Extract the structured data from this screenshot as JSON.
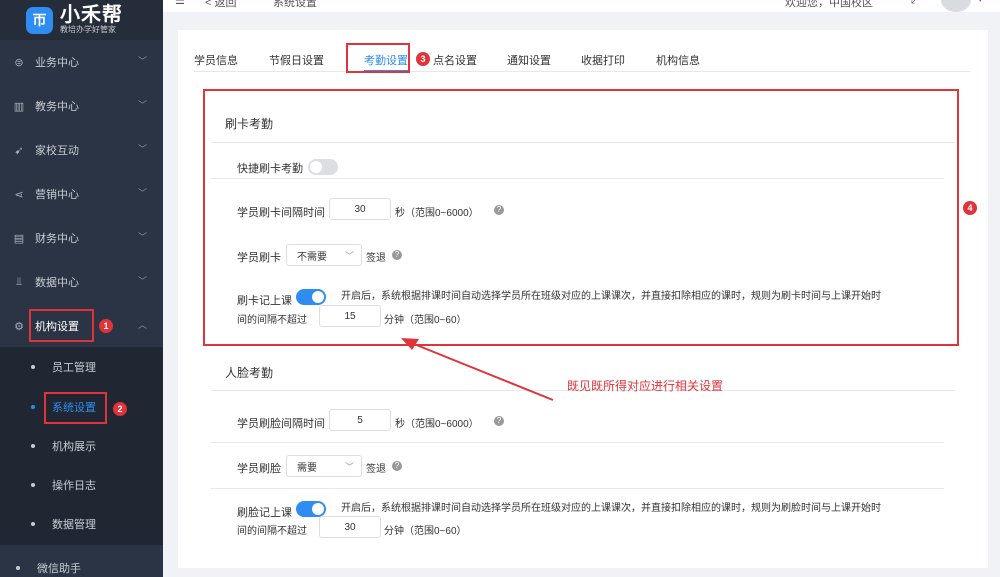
{
  "brand": {
    "logo_char": "帀",
    "name": "小禾帮",
    "tagline": "教培办学好管家"
  },
  "topbar": {
    "back_label": "< 返回",
    "page_label": "系统设置",
    "account_text": "欢迎您，中国校区"
  },
  "sidebar": {
    "items": [
      {
        "label": "业务中心",
        "icon": "briefcase-icon",
        "glyph": "⊜"
      },
      {
        "label": "教务中心",
        "icon": "book-icon",
        "glyph": "▥"
      },
      {
        "label": "家校互动",
        "icon": "send-icon",
        "glyph": "➹"
      },
      {
        "label": "营销中心",
        "icon": "share-icon",
        "glyph": "⋖"
      },
      {
        "label": "财务中心",
        "icon": "wallet-icon",
        "glyph": "▤"
      },
      {
        "label": "数据中心",
        "icon": "chart-icon",
        "glyph": "⫫"
      },
      {
        "label": "机构设置",
        "icon": "gear-icon",
        "glyph": "⚙"
      }
    ],
    "sub_items": [
      {
        "label": "员工管理"
      },
      {
        "label": "系统设置"
      },
      {
        "label": "机构展示"
      },
      {
        "label": "操作日志"
      },
      {
        "label": "数据管理"
      }
    ],
    "bottom_item": {
      "label": "微信助手"
    }
  },
  "tabs": [
    {
      "label": "学员信息"
    },
    {
      "label": "节假日设置"
    },
    {
      "label": "考勤设置"
    },
    {
      "label": "点名设置"
    },
    {
      "label": "通知设置"
    },
    {
      "label": "收据打印"
    },
    {
      "label": "机构信息"
    }
  ],
  "card_attendance": {
    "title": "刷卡考勤",
    "quick_label": "快捷刷卡考勤",
    "interval_label": "学员刷卡间隔时间",
    "interval_value": "30",
    "interval_unit": "秒（范围0~6000）",
    "swipe_label": "学员刷卡",
    "swipe_select": "不需要",
    "swipe_suffix": "签退",
    "auto_label": "刷卡记上课",
    "auto_desc_1": "开启后，系统根据排课时间自动选择学员所在班级对应的上课课次，并直接扣除相应的课时，规则为刷卡时间与上课开始时",
    "auto_desc_2": "间的间隔不超过",
    "auto_value": "15",
    "auto_unit": "分钟（范围0~60）"
  },
  "face_attendance": {
    "title": "人脸考勤",
    "interval_label": "学员刷脸间隔时间",
    "interval_value": "5",
    "interval_unit": "秒（范围0~6000）",
    "swipe_label": "学员刷脸",
    "swipe_select": "需要",
    "swipe_suffix": "签退",
    "auto_label": "刷脸记上课",
    "auto_desc_1": "开启后，系统根据排课时间自动选择学员所在班级对应的上课课次，并直接扣除相应的课时，规则为刷脸时间与上课开始时",
    "auto_desc_2": "间的间隔不超过",
    "auto_value": "30",
    "auto_unit": "分钟（范围0~60）"
  },
  "annotations": {
    "badges": [
      "1",
      "2",
      "3",
      "4"
    ],
    "note": "既见既所得对应进行相关设置"
  },
  "colors": {
    "sidebar_bg": "#2b3444",
    "accent": "#2f8cf0",
    "annotation": "#e0333a"
  }
}
